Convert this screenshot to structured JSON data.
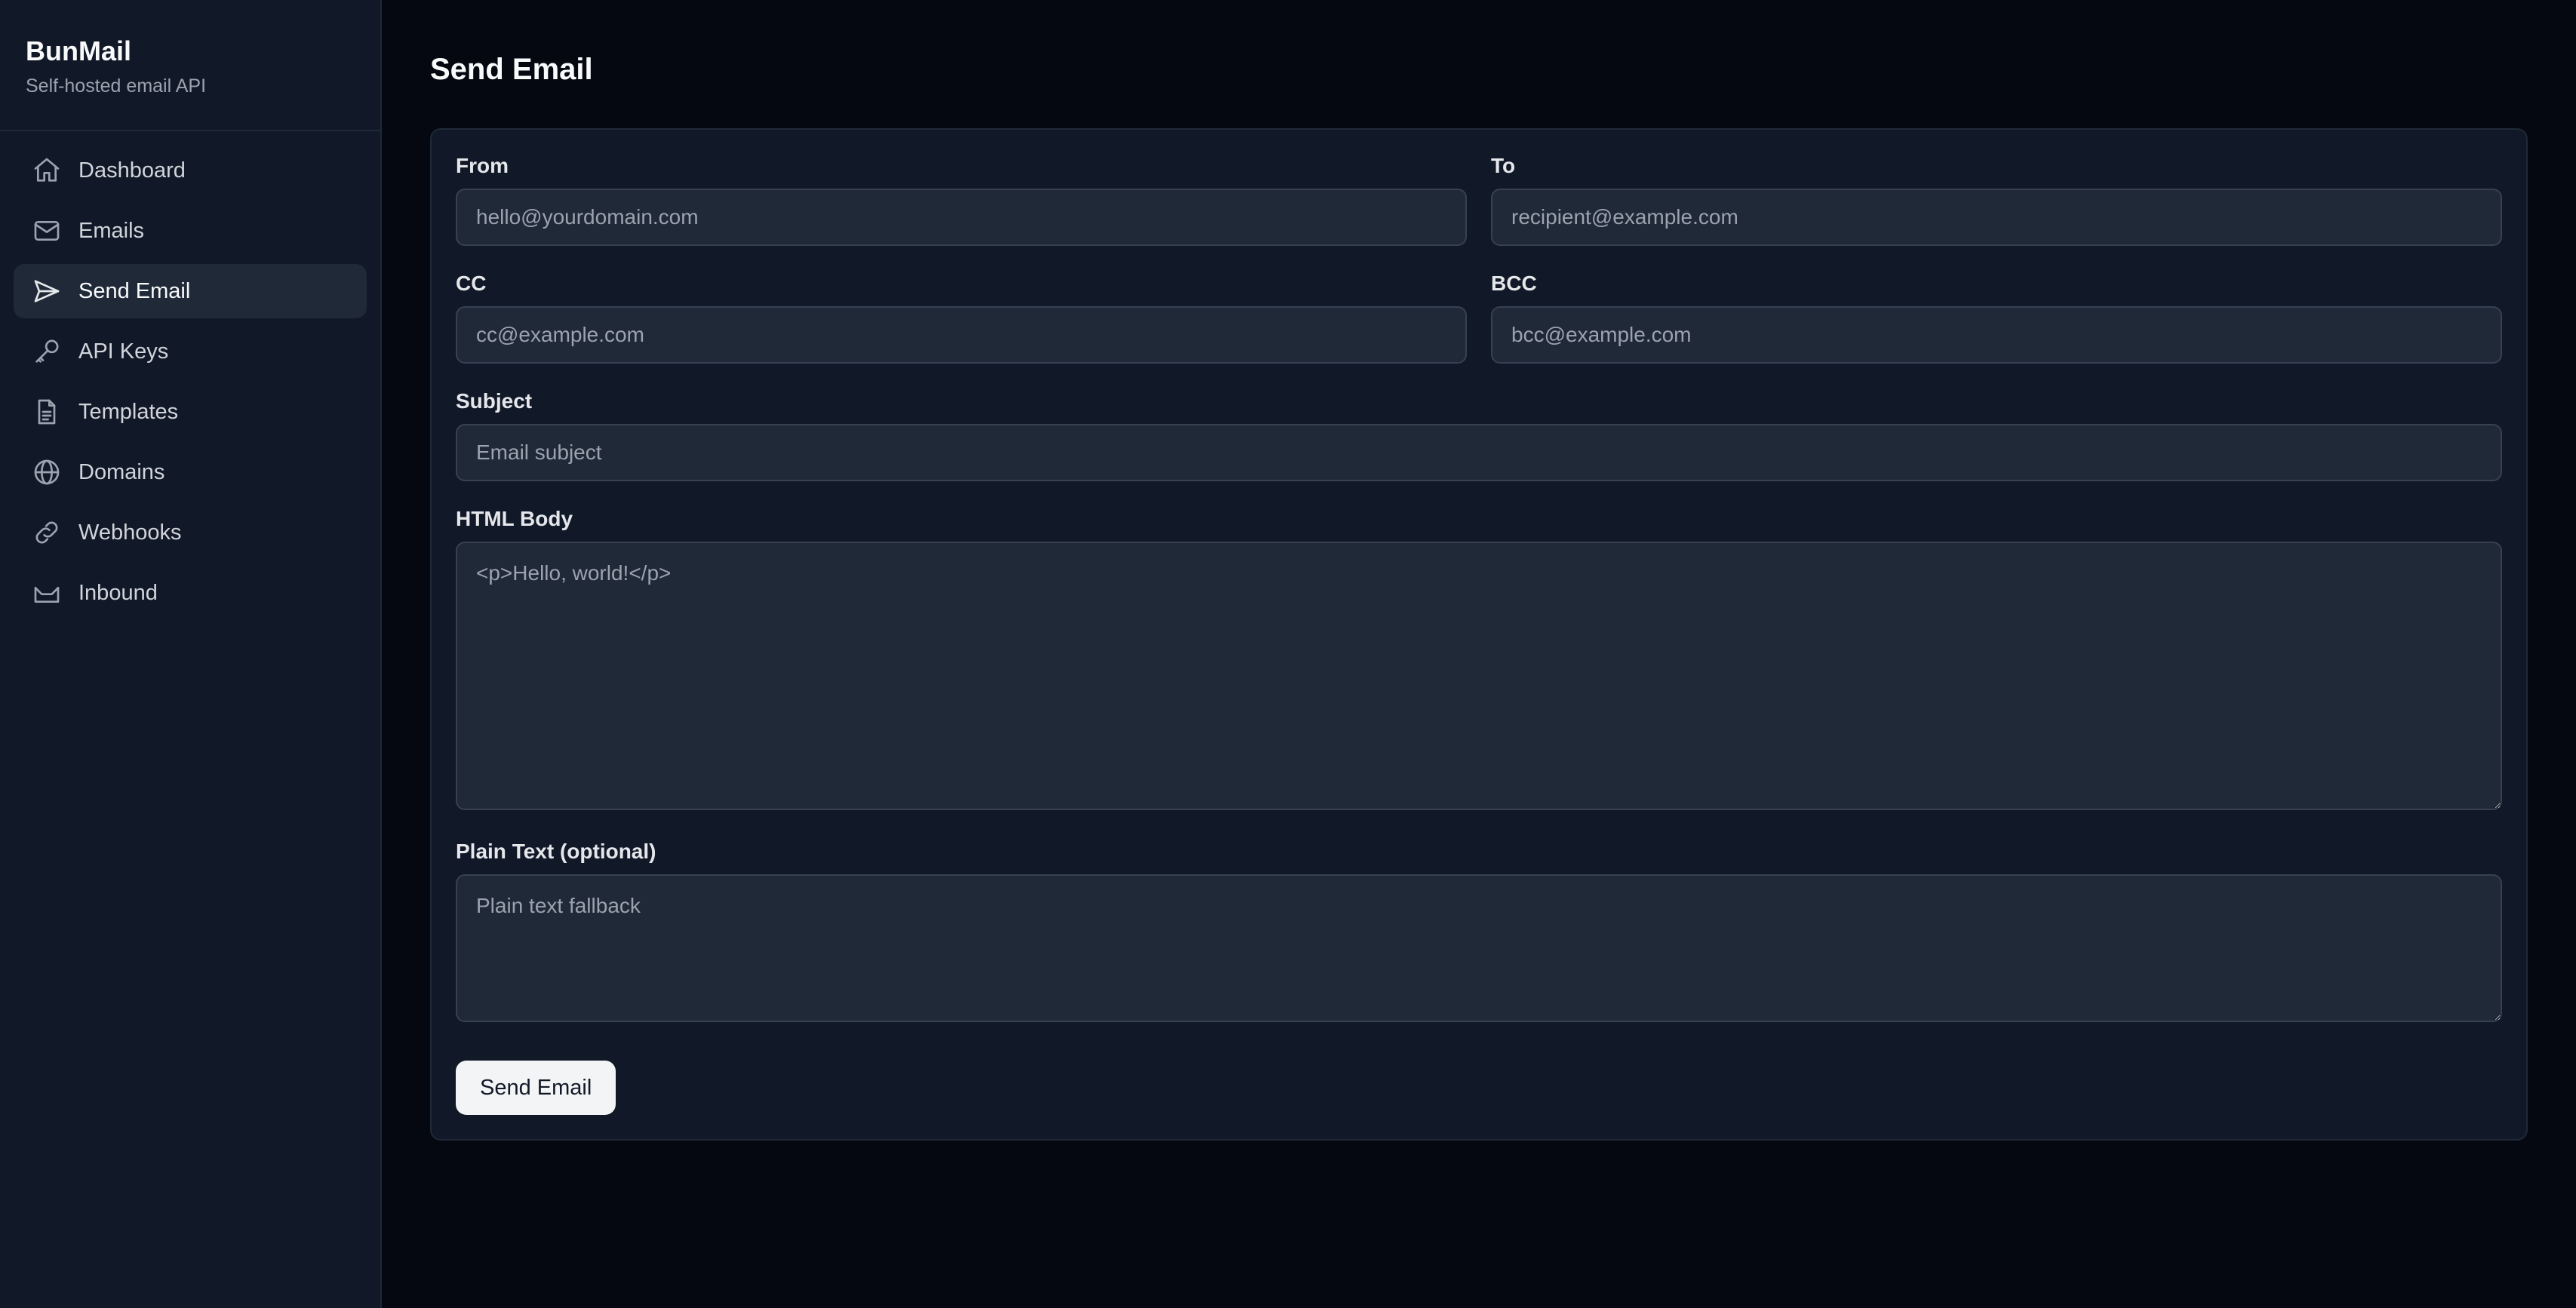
{
  "app": {
    "title": "BunMail",
    "subtitle": "Self-hosted email API"
  },
  "sidebar": {
    "items": [
      {
        "label": "Dashboard",
        "icon": "home-icon",
        "active": false
      },
      {
        "label": "Emails",
        "icon": "mail-icon",
        "active": false
      },
      {
        "label": "Send Email",
        "icon": "send-icon",
        "active": true
      },
      {
        "label": "API Keys",
        "icon": "key-icon",
        "active": false
      },
      {
        "label": "Templates",
        "icon": "file-text-icon",
        "active": false
      },
      {
        "label": "Domains",
        "icon": "globe-icon",
        "active": false
      },
      {
        "label": "Webhooks",
        "icon": "webhook-icon",
        "active": false
      },
      {
        "label": "Inbound",
        "icon": "inbox-icon",
        "active": false
      }
    ]
  },
  "page": {
    "title": "Send Email"
  },
  "form": {
    "from": {
      "label": "From",
      "placeholder": "hello@yourdomain.com",
      "value": ""
    },
    "to": {
      "label": "To",
      "placeholder": "recipient@example.com",
      "value": ""
    },
    "cc": {
      "label": "CC",
      "placeholder": "cc@example.com",
      "value": ""
    },
    "bcc": {
      "label": "BCC",
      "placeholder": "bcc@example.com",
      "value": ""
    },
    "subject": {
      "label": "Subject",
      "placeholder": "Email subject",
      "value": ""
    },
    "html_body": {
      "label": "HTML Body",
      "placeholder": "<p>Hello, world!</p>",
      "value": ""
    },
    "plain_text": {
      "label": "Plain Text (optional)",
      "placeholder": "Plain text fallback",
      "value": ""
    },
    "submit_label": "Send Email"
  },
  "colors": {
    "page_bg": "#050810",
    "sidebar_bg": "#111827",
    "card_bg": "#111827",
    "input_bg": "#1f2937",
    "border": "#374151",
    "button_bg": "#f3f4f6"
  }
}
